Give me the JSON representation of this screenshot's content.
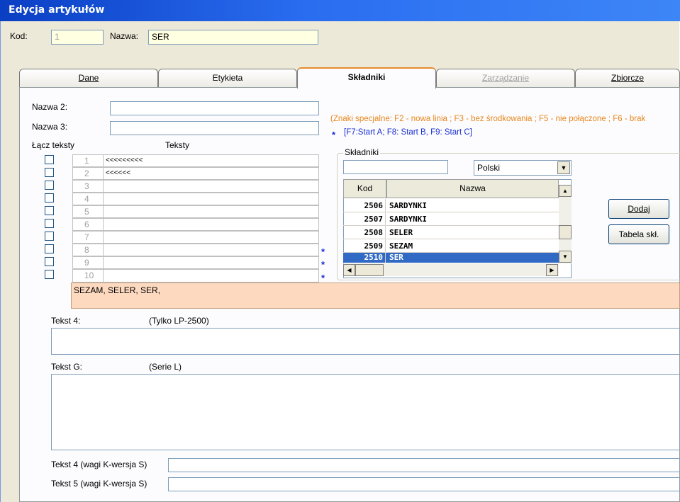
{
  "window": {
    "title": "Edycja artykułów"
  },
  "header": {
    "kod_label": "Kod:",
    "kod_value": "1",
    "nazwa_label": "Nazwa:",
    "nazwa_value": "SER"
  },
  "tabs": [
    {
      "label": "Dane",
      "state": "normal"
    },
    {
      "label": "Etykieta",
      "state": "normal"
    },
    {
      "label": "Składniki",
      "state": "active"
    },
    {
      "label": "Zarządzanie",
      "state": "disabled"
    },
    {
      "label": "Zbiorcze",
      "state": "normal"
    }
  ],
  "form": {
    "nazwa2_label": "Nazwa 2:",
    "nazwa2_value": "",
    "nazwa3_label": "Nazwa 3:",
    "nazwa3_value": "",
    "lacz_teksty_label": "Łącz teksty",
    "teksty_label": "Teksty",
    "hint_line1": "(Znaki specjalne: F2 - nowa linia ; F3 - bez środkowania ; F5 - nie połączone ; F6 - brak",
    "hint_line2": "[F7:Start A; F8: Start B, F9: Start C]",
    "star": "*"
  },
  "text_rows": [
    {
      "num": "1",
      "text": "<<<<<<<<<"
    },
    {
      "num": "2",
      "text": "<<<<<<"
    },
    {
      "num": "3",
      "text": ""
    },
    {
      "num": "4",
      "text": ""
    },
    {
      "num": "5",
      "text": ""
    },
    {
      "num": "6",
      "text": ""
    },
    {
      "num": "7",
      "text": ""
    },
    {
      "num": "8",
      "text": ""
    },
    {
      "num": "9",
      "text": ""
    },
    {
      "num": "10",
      "text": ""
    }
  ],
  "skladniki": {
    "group_label": "Składniki",
    "search_value": "",
    "language": "Polski",
    "col_kod": "Kod",
    "col_nazwa": "Nazwa",
    "rows": [
      {
        "kod": "2506",
        "nazwa": "SARDYNKI",
        "selected": false
      },
      {
        "kod": "2507",
        "nazwa": "SARDYNKI",
        "selected": false
      },
      {
        "kod": "2508",
        "nazwa": "SELER",
        "selected": false
      },
      {
        "kod": "2509",
        "nazwa": "SEZAM",
        "selected": false
      },
      {
        "kod": "2510",
        "nazwa": "SER",
        "selected": true
      }
    ],
    "dodaj_label": "Dodaj",
    "tabela_label": "Tabela skł."
  },
  "summary_text": "SEZAM, SELER, SER,",
  "tekst4": {
    "label": "Tekst 4:",
    "note": "(Tylko LP-2500)",
    "value": ""
  },
  "tekstG": {
    "label": "Tekst G:",
    "note": "(Serie L)",
    "value": ""
  },
  "tekst4_wagi": {
    "label": "Tekst 4 (wagi K-wersja S)",
    "value": ""
  },
  "tekst5_wagi": {
    "label": "Tekst 5 (wagi K-wersja S)",
    "value": ""
  },
  "colors": {
    "titlebar": "#0a3fc4",
    "hint_orange": "#e8861c",
    "hint_blue": "#1a2fd0",
    "summary_bg": "#fcd9bf",
    "selection": "#316ac5"
  }
}
